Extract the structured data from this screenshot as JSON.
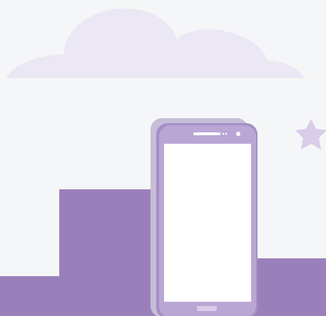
{
  "palette": {
    "background": "#f5f6f7",
    "cloud": "#ece7f4",
    "block": "#9a80bb",
    "phone_shadow": "#c6bed6",
    "phone_body": "#b9a6d4",
    "phone_edge": "#a58fc6",
    "screen": "#ffffff",
    "star": "#d9cde9",
    "speaker": "#ffffff",
    "home_button": "#d8cce8"
  },
  "icons": {
    "cloud": "cloud-icon",
    "star": "star-icon",
    "phone": "smartphone-icon"
  }
}
